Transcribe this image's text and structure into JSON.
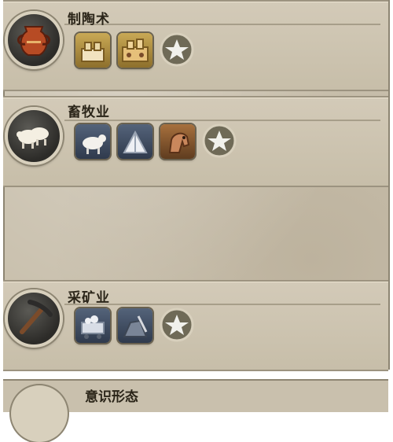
{
  "techs": [
    {
      "title": "制陶术",
      "icon": "pottery-icon",
      "unlocks": [
        "granary-icon",
        "pottery-workshop-icon",
        "star-icon"
      ]
    },
    {
      "title": "畜牧业",
      "icon": "sheep-icon",
      "unlocks": [
        "cattle-icon",
        "tent-icon",
        "horse-icon",
        "star-icon"
      ]
    },
    {
      "title": "采矿业",
      "icon": "pickaxe-icon",
      "unlocks": [
        "mine-cart-icon",
        "quarry-icon",
        "star-icon"
      ]
    }
  ],
  "next_tech_title": "意识形态",
  "colors": {
    "parchment": "#c9c0ad",
    "border": "#8d8572",
    "text": "#2a2418"
  }
}
